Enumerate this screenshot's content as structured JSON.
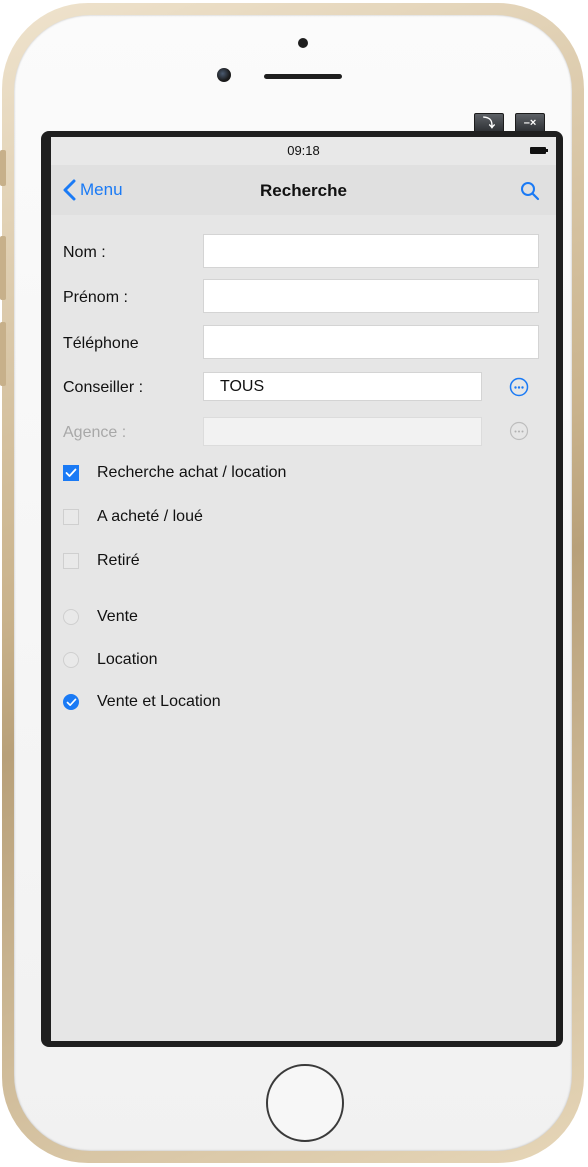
{
  "status_bar": {
    "time": "09:18"
  },
  "nav": {
    "back_label": "Menu",
    "title": "Recherche"
  },
  "form": {
    "fields": [
      {
        "label": "Nom :",
        "value": "",
        "enabled": true
      },
      {
        "label": "Prénom :",
        "value": "",
        "enabled": true
      },
      {
        "label": "Téléphone",
        "value": "",
        "enabled": true
      },
      {
        "label": "Conseiller :",
        "value": "TOUS",
        "enabled": true
      },
      {
        "label": "Agence :",
        "value": "",
        "enabled": false
      }
    ],
    "checkboxes": [
      {
        "label": "Recherche achat / location",
        "checked": true
      },
      {
        "label": "A acheté / loué",
        "checked": false
      },
      {
        "label": "Retiré",
        "checked": false
      }
    ],
    "radios": [
      {
        "label": "Vente",
        "selected": false
      },
      {
        "label": "Location",
        "selected": false
      },
      {
        "label": "Vente et Location",
        "selected": true
      }
    ]
  },
  "colors": {
    "accent": "#1a7af5",
    "disabled_text": "#a8a8a8"
  }
}
